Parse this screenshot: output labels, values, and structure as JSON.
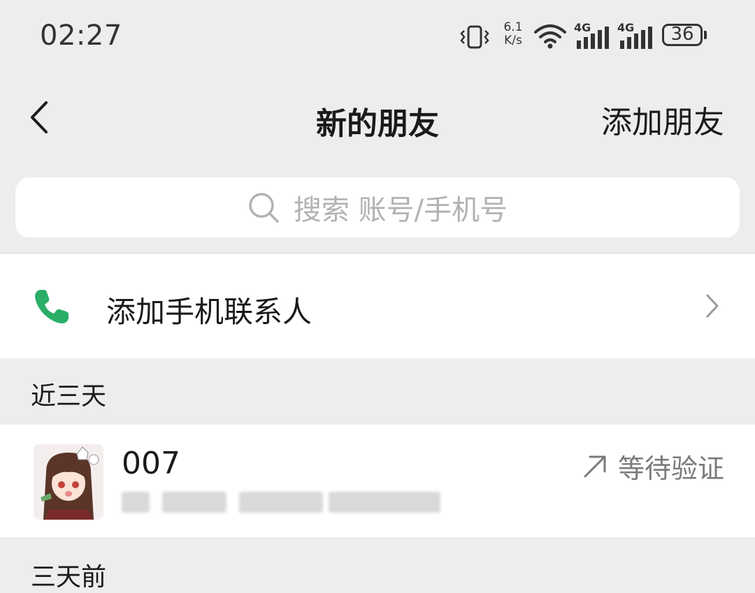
{
  "status_bar": {
    "time": "02:27",
    "speed_value": "6.1",
    "speed_unit": "K/s",
    "signal1_label": "4G",
    "signal2_label": "4G",
    "battery": "36",
    "icons": [
      "vibrate-icon",
      "wifi-icon",
      "signal-icon",
      "signal-icon",
      "battery-icon"
    ]
  },
  "nav": {
    "title": "新的朋友",
    "action": "添加朋友",
    "back_icon": "chevron-left-icon"
  },
  "search": {
    "placeholder": "搜索 账号/手机号",
    "icon": "search-icon"
  },
  "phone_contacts": {
    "label": "添加手机联系人",
    "icon": "phone-icon",
    "accent_color": "#2aae67"
  },
  "sections": {
    "recent": "近三天",
    "older": "三天前"
  },
  "requests": [
    {
      "name": "007",
      "status": "等待验证",
      "status_icon": "arrow-up-right-icon"
    }
  ]
}
